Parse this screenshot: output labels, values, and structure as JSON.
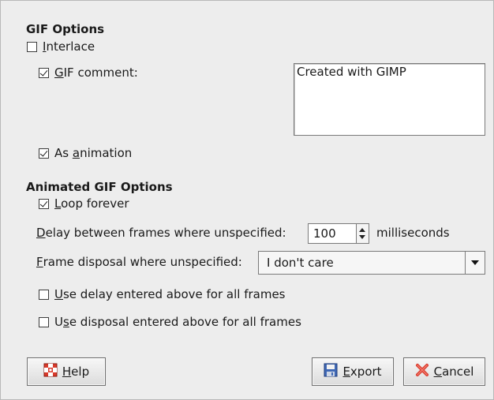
{
  "gif_options": {
    "heading": "GIF Options",
    "interlace": {
      "pre": "",
      "mn": "I",
      "post": "nterlace",
      "checked": false
    },
    "gif_comment": {
      "pre": "",
      "mn": "G",
      "post": "IF comment:",
      "checked": true
    },
    "comment_text": "Created with GIMP",
    "as_animation": {
      "pre": "As ",
      "mn": "a",
      "post": "nimation",
      "checked": true
    }
  },
  "animated_options": {
    "heading": "Animated GIF Options",
    "loop_forever": {
      "pre": "",
      "mn": "L",
      "post": "oop forever",
      "checked": true
    },
    "delay_label": {
      "pre": "",
      "mn": "D",
      "post": "elay between frames where unspecified:"
    },
    "delay_value": "100",
    "delay_unit": "milliseconds",
    "disposal_label": {
      "pre": "",
      "mn": "F",
      "post": "rame disposal where unspecified:"
    },
    "disposal_value": "I don't care",
    "use_delay_all": {
      "pre": "",
      "mn": "U",
      "post": "se delay entered above for all frames",
      "checked": false
    },
    "use_disposal_all": {
      "pre": "U",
      "mn": "s",
      "post": "e disposal entered above for all frames",
      "checked": false
    }
  },
  "buttons": {
    "help": {
      "pre": "",
      "mn": "H",
      "post": "elp",
      "icon": "help-lifebuoy-icon"
    },
    "export": {
      "pre": "",
      "mn": "E",
      "post": "xport",
      "icon": "floppy-disk-icon"
    },
    "cancel": {
      "pre": "",
      "mn": "C",
      "post": "ancel",
      "icon": "cancel-x-icon"
    }
  }
}
